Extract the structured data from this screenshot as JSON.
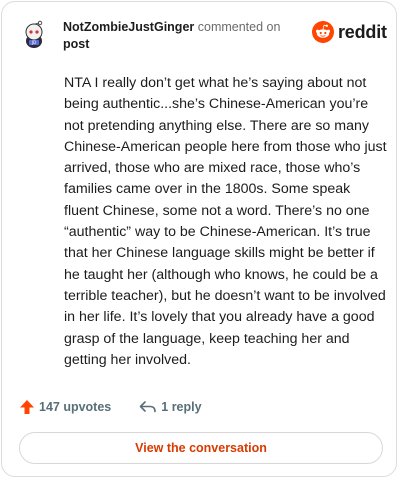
{
  "comment": {
    "author": "NotZombieJustGinger",
    "action_text": "commented on",
    "target": "post",
    "body": "NTA I really don’t get what he’s saying about not being authentic...she’s Chinese-American you’re not pretending anything else. There are so many Chinese-American people here from those who just arrived, those who are mixed race, those who’s families came over in the 1800s. Some speak fluent Chinese, some not a word. There’s no one “authentic” way to be Chinese-American. It’s true that her Chinese language skills might be better if he taught her (although who knows, he could be a terrible teacher), but he doesn’t want to be involved in her life. It’s lovely that you already have a good grasp of the language, keep teaching her and getting her involved."
  },
  "brand": {
    "name": "reddit",
    "color": "#ff4500"
  },
  "footer": {
    "upvotes": "147 upvotes",
    "replies": "1 reply",
    "upvote_color": "#ff4500"
  },
  "actions": {
    "view_conversation": "View the conversation",
    "accent": "#d93a00"
  }
}
